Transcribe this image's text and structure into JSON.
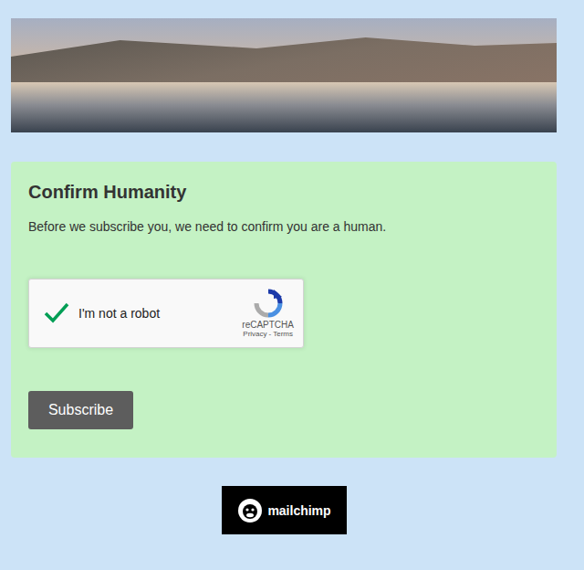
{
  "form": {
    "title": "Confirm Humanity",
    "message": "Before we subscribe you, we need to confirm you are a human."
  },
  "captcha": {
    "label": "I'm not a robot",
    "checked": true,
    "brand": "reCAPTCHA",
    "links": [
      "Privacy",
      "Terms"
    ],
    "separator": "-"
  },
  "buttons": [
    "Subscribe"
  ],
  "footer": {
    "logo": "mailchimp"
  }
}
